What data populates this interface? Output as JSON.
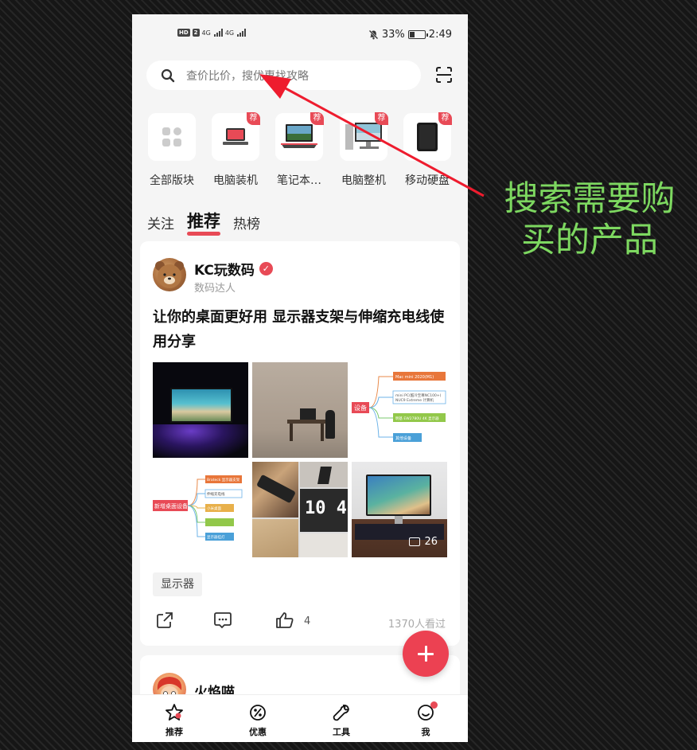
{
  "status_bar": {
    "hd": "HD",
    "sim": "2",
    "net1": "4G",
    "net2": "4G",
    "battery": "33%",
    "time": "2:49"
  },
  "search": {
    "placeholder": "查价比价，搜优惠找攻略"
  },
  "categories": [
    {
      "label": "全部版块",
      "badge": ""
    },
    {
      "label": "电脑装机",
      "badge": "荐"
    },
    {
      "label": "笔记本…",
      "badge": "荐"
    },
    {
      "label": "电脑整机",
      "badge": "荐"
    },
    {
      "label": "移动硬盘",
      "badge": "荐"
    }
  ],
  "feed_tabs": [
    "关注",
    "推荐",
    "热榜"
  ],
  "active_tab": "推荐",
  "post": {
    "author": "KC玩数码",
    "author_title": "数码达人",
    "title": "让你的桌面更好用 显示器支架与伸缩充电线使用分享",
    "image_count": "26",
    "tag": "显示器",
    "likes": "4",
    "views": "1370人看过",
    "mindmap1": [
      "设备",
      "Mac mini 2020(M1)",
      "mini PC(酷冷至尊NC100+)",
      "NUC9 Extreme 计算机",
      "明基 EW2780U 4K 显示器",
      "其他设备"
    ],
    "mindmap2": [
      "新增桌面设备",
      "Brateck 显示器支架",
      "伸缩充电线",
      "小米桌面",
      "显示器挂灯"
    ],
    "clock_text": "10 4"
  },
  "post2": {
    "author": "火焰喵"
  },
  "bottom_nav": [
    {
      "label": "推荐",
      "icon": "star-icon"
    },
    {
      "label": "优惠",
      "icon": "coupon-icon"
    },
    {
      "label": "工具",
      "icon": "wrench-icon"
    },
    {
      "label": "我",
      "icon": "face-icon"
    }
  ],
  "annotation": {
    "line1": "搜索需要购",
    "line2": "买的产品"
  },
  "colors": {
    "accent": "#e84a56",
    "annotation": "#7dd860",
    "arrow": "#ee1c2e"
  }
}
